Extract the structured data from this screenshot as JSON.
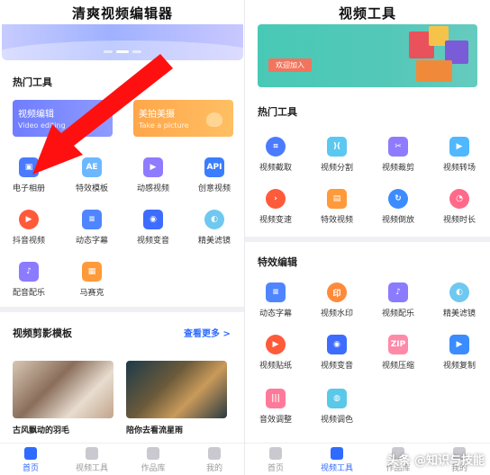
{
  "left": {
    "title": "清爽视频编辑器",
    "hot_tools_title": "热门工具",
    "cards": [
      {
        "title": "视频编辑",
        "subtitle": "Video editing"
      },
      {
        "title": "美拍美摄",
        "subtitle": "Take a picture"
      }
    ],
    "tools": [
      {
        "label": "电子相册",
        "icon": "album-icon",
        "color": "#4a7bff"
      },
      {
        "label": "特效模板",
        "icon": "template-icon",
        "color": "#6cb8ff"
      },
      {
        "label": "动感视频",
        "icon": "motion-video-icon",
        "color": "#8f7bff"
      },
      {
        "label": "创意视频",
        "icon": "api-icon",
        "color": "#3a7dff"
      },
      {
        "label": "抖音视频",
        "icon": "play-icon",
        "color": "#ff5a3a"
      },
      {
        "label": "动态字幕",
        "icon": "subtitle-icon",
        "color": "#4f86ff"
      },
      {
        "label": "视频变音",
        "icon": "voice-change-icon",
        "color": "#3d6cff"
      },
      {
        "label": "精美滤镜",
        "icon": "filter-icon",
        "color": "#6fc8f0"
      },
      {
        "label": "配音配乐",
        "icon": "music-icon",
        "color": "#8a7bff"
      },
      {
        "label": "马赛克",
        "icon": "mosaic-icon",
        "color": "#ff9a3a"
      }
    ],
    "templates_title": "视频剪影模板",
    "more_label": "查看更多 >",
    "thumbs": [
      {
        "caption": "古风飘动的羽毛"
      },
      {
        "caption": "陪你去看流星雨"
      }
    ],
    "tabs": [
      {
        "label": "首页",
        "active": true
      },
      {
        "label": "视频工具",
        "active": false
      },
      {
        "label": "作品库",
        "active": false
      },
      {
        "label": "我的",
        "active": false
      }
    ]
  },
  "right": {
    "title": "视频工具",
    "banner_button": "欢迎加入",
    "hot_tools_title": "热门工具",
    "tools": [
      {
        "label": "视频截取",
        "icon": "crop-icon",
        "color": "#4a7bff"
      },
      {
        "label": "视频分割",
        "icon": "split-icon",
        "color": "#5ac8f0"
      },
      {
        "label": "视频裁剪",
        "icon": "scissors-icon",
        "color": "#8f7bff"
      },
      {
        "label": "视频转场",
        "icon": "transition-icon",
        "color": "#4fb8ff"
      },
      {
        "label": "视频变速",
        "icon": "speed-icon",
        "color": "#ff5a3a"
      },
      {
        "label": "特效视频",
        "icon": "effect-icon",
        "color": "#ff9a3a"
      },
      {
        "label": "视频倒放",
        "icon": "reverse-icon",
        "color": "#3d8cff"
      },
      {
        "label": "视频时长",
        "icon": "clock-icon",
        "color": "#ff6a8a"
      }
    ],
    "edit_title": "特效编辑",
    "edit_tools": [
      {
        "label": "动态字幕",
        "icon": "subtitle-icon",
        "color": "#4f86ff"
      },
      {
        "label": "视频水印",
        "icon": "watermark-icon",
        "color": "#ff8a3a"
      },
      {
        "label": "视频配乐",
        "icon": "music-icon",
        "color": "#8a7bff"
      },
      {
        "label": "精美滤镜",
        "icon": "filter-icon",
        "color": "#6fc8f0"
      },
      {
        "label": "视频贴纸",
        "icon": "sticker-icon",
        "color": "#ff5a3a"
      },
      {
        "label": "视频变音",
        "icon": "voice-change-icon",
        "color": "#3d6cff"
      },
      {
        "label": "视频压缩",
        "icon": "zip-icon",
        "color": "#ff8aa8"
      },
      {
        "label": "视频复制",
        "icon": "copy-icon",
        "color": "#3a8cff"
      },
      {
        "label": "音效调整",
        "icon": "equalizer-icon",
        "color": "#ff7a9a"
      },
      {
        "label": "视频调色",
        "icon": "palette-icon",
        "color": "#5ac8e8"
      }
    ],
    "tabs": [
      {
        "label": "首页",
        "active": false
      },
      {
        "label": "视频工具",
        "active": true
      },
      {
        "label": "作品库",
        "active": false
      },
      {
        "label": "我的",
        "active": false
      }
    ]
  },
  "watermark": "头条 @知识与技能",
  "accent_color": "#2f6bff",
  "arrow_color": "#ff1010"
}
